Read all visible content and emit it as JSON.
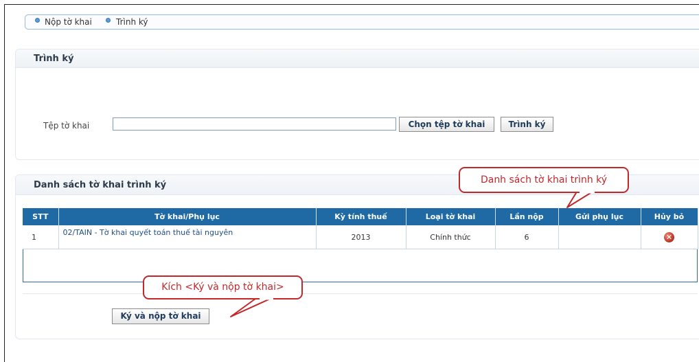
{
  "breadcrumb": {
    "items": [
      "Nộp tờ khai",
      "Trình ký"
    ]
  },
  "sign_panel": {
    "title": "Trình ký",
    "file_label": "Tệp tờ khai",
    "file_value": "",
    "choose_button": "Chọn tệp tờ khai",
    "sign_button": "Trình ký"
  },
  "list_panel": {
    "title": "Danh sách tờ khai trình ký",
    "columns": [
      "STT",
      "Tờ khai/Phụ lục",
      "Kỳ tính thuế",
      "Loại tờ khai",
      "Lần nộp",
      "Gửi phụ lục",
      "Hủy bỏ"
    ],
    "rows": [
      {
        "stt": "1",
        "form": "02/TAIN - Tờ khai quyết toán thuế tài nguyên",
        "period": "2013",
        "type": "Chính thức",
        "times": "6",
        "appendix": ""
      }
    ],
    "submit_button": "Ký và nộp tờ khai"
  },
  "callouts": {
    "list": "Danh sách tờ khai trình ký",
    "submit": "Kích <Ký và nộp tờ khai>"
  },
  "colors": {
    "header_bg": "#1f6aa5",
    "callout": "#c0282a",
    "delete_icon": "#c0392b"
  },
  "icons": {
    "breadcrumb_bullet": "bullet-dot-icon",
    "delete": "delete-x-icon"
  }
}
